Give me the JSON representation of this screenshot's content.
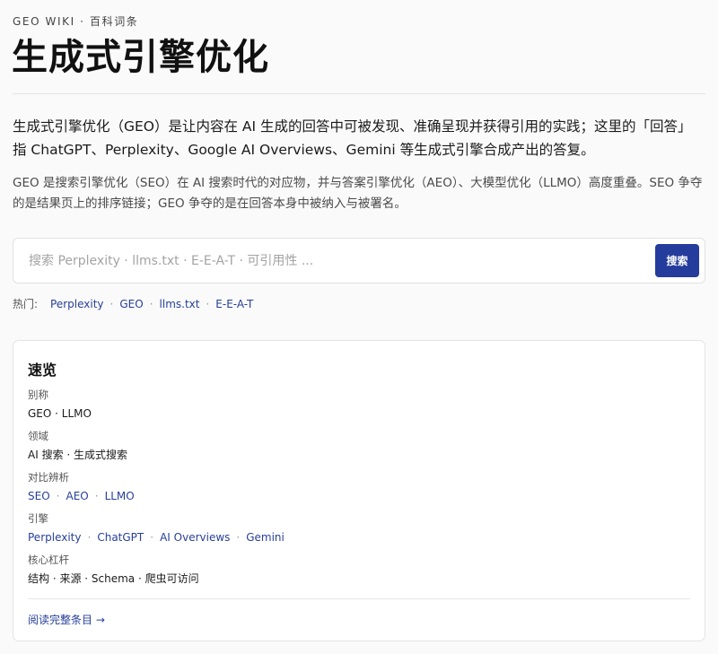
{
  "header": {
    "eyebrow": "GEO WIKI · 百科词条",
    "title": "生成式引擎优化"
  },
  "intro": {
    "lead": "生成式引擎优化（GEO）是让内容在 AI 生成的回答中可被发现、准确呈现并获得引用的实践；这里的「回答」指 ChatGPT、Perplexity、Google AI Overviews、Gemini 等生成式引擎合成产出的答复。",
    "sub": "GEO 是搜索引擎优化（SEO）在 AI 搜索时代的对应物，并与答案引擎优化（AEO）、大模型优化（LLMO）高度重叠。SEO 争夺的是结果页上的排序链接；GEO 争夺的是在回答本身中被纳入与被署名。"
  },
  "search": {
    "placeholder": "搜索 Perplexity · llms.txt · E-E-A-T · 可引用性 ...",
    "value": "",
    "button_label": "搜索"
  },
  "hot": {
    "label": "热门:",
    "items": [
      "Perplexity",
      "GEO",
      "llms.txt",
      "E-E-A-T"
    ]
  },
  "overview": {
    "title": "速览",
    "fields": [
      {
        "label": "别称",
        "value": "GEO · LLMO"
      },
      {
        "label": "领域",
        "value": "AI 搜索 · 生成式搜索"
      },
      {
        "label": "对比辨析",
        "links": [
          "SEO",
          "AEO",
          "LLMO"
        ]
      },
      {
        "label": "引擎",
        "links": [
          "Perplexity",
          "ChatGPT",
          "AI Overviews",
          "Gemini"
        ]
      },
      {
        "label": "核心杠杆",
        "value": "结构 · 来源 · Schema · 爬虫可访问"
      }
    ],
    "more_link": "阅读完整条目 →"
  },
  "colors": {
    "accent": "#243c9c",
    "link": "#27409a",
    "background": "#fafafa"
  }
}
